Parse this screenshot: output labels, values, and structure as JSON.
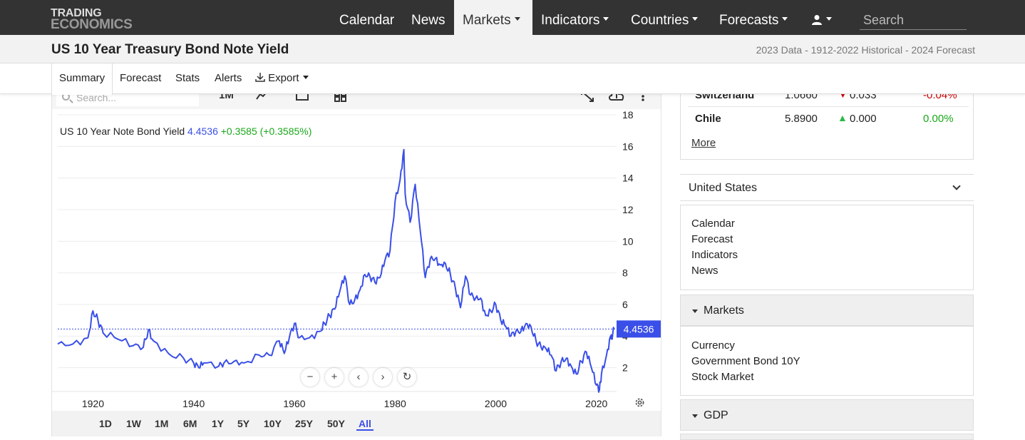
{
  "brand": {
    "line1": "TRADING",
    "line2": "ECONOMICS"
  },
  "nav": {
    "items": [
      {
        "label": "Calendar",
        "dropdown": false
      },
      {
        "label": "News",
        "dropdown": false
      },
      {
        "label": "Markets",
        "dropdown": true,
        "active": true
      },
      {
        "label": "Indicators",
        "dropdown": true
      },
      {
        "label": "Countries",
        "dropdown": true
      },
      {
        "label": "Forecasts",
        "dropdown": true
      }
    ],
    "search_placeholder": "Search"
  },
  "header": {
    "title": "US 10 Year Treasury Bond Note Yield",
    "meta": "2023 Data - 1912-2022 Historical - 2024 Forecast"
  },
  "tabs": [
    "Summary",
    "Forecast",
    "Stats",
    "Alerts",
    "Export"
  ],
  "chart_toolbar": {
    "search_placeholder": "Search...",
    "interval": "1M"
  },
  "chart_legend": {
    "name": "US 10 Year Note Bond Yield",
    "value": "4.4536",
    "change": "+0.3585 (+0.3585%)"
  },
  "chart_controls": [
    "−",
    "+",
    "‹",
    "›",
    "↻"
  ],
  "range_buttons": [
    "1D",
    "1W",
    "1M",
    "6M",
    "1Y",
    "5Y",
    "10Y",
    "25Y",
    "50Y",
    "All"
  ],
  "range_active": "All",
  "markets_table": {
    "rows": [
      {
        "name": "Switzerland",
        "price": "1.0660",
        "change": "0.033",
        "pct": "-0.04%",
        "direction": "down"
      },
      {
        "name": "Chile",
        "price": "5.8900",
        "change": "0.000",
        "pct": "0.00%",
        "direction": "up"
      }
    ],
    "more_label": "More"
  },
  "country_select": "United States",
  "country_links": [
    "Calendar",
    "Forecast",
    "Indicators",
    "News"
  ],
  "markets_section": {
    "title": "Markets",
    "links": [
      "Currency",
      "Government Bond 10Y",
      "Stock Market"
    ]
  },
  "gdp_section": {
    "title": "GDP"
  },
  "colors": {
    "series": "#3a4fe8",
    "up": "#1aa81a",
    "down": "#cc0000",
    "nav_bg": "#333333"
  },
  "chart_data": {
    "type": "line",
    "series": [
      {
        "name": "US 10 Year Note Bond Yield",
        "x": [
          1913,
          1916,
          1919,
          1920,
          1921,
          1922,
          1925,
          1928,
          1930,
          1931,
          1932,
          1935,
          1938,
          1940,
          1941,
          1942,
          1945,
          1946,
          1948,
          1950,
          1953,
          1955,
          1957,
          1958,
          1959,
          1960,
          1961,
          1963,
          1965,
          1966,
          1967,
          1968,
          1969,
          1970,
          1971,
          1972,
          1973,
          1974,
          1975,
          1976,
          1977,
          1978,
          1979,
          1980,
          1981,
          1981.75,
          1982,
          1983,
          1984,
          1985,
          1986,
          1987,
          1988,
          1989,
          1990,
          1991,
          1992,
          1993,
          1994,
          1995,
          1996,
          1997,
          1998,
          1999,
          2000,
          2001,
          2002,
          2003,
          2004,
          2005,
          2006,
          2007,
          2008,
          2009,
          2010,
          2011,
          2012,
          2013,
          2014,
          2015,
          2016,
          2017,
          2018,
          2019,
          2020,
          2020.6,
          2021,
          2022,
          2022.8,
          2023,
          2023.5
        ],
        "y": [
          3.5,
          3.5,
          3.9,
          5.6,
          5.0,
          4.2,
          3.8,
          3.4,
          3.3,
          4.4,
          3.7,
          2.9,
          2.6,
          2.3,
          2.0,
          2.3,
          2.1,
          2.3,
          2.4,
          2.3,
          2.8,
          2.8,
          3.7,
          2.9,
          3.9,
          4.8,
          3.9,
          3.9,
          4.3,
          4.8,
          5.3,
          5.7,
          6.8,
          7.8,
          6.0,
          6.3,
          6.9,
          7.9,
          7.8,
          7.4,
          7.7,
          8.8,
          9.4,
          12.5,
          13.9,
          15.8,
          13.0,
          11.2,
          13.6,
          10.7,
          7.7,
          8.9,
          8.9,
          8.5,
          8.6,
          7.9,
          7.0,
          5.8,
          7.8,
          6.6,
          6.4,
          6.4,
          5.3,
          5.6,
          6.0,
          5.0,
          4.6,
          4.0,
          4.3,
          4.3,
          4.8,
          4.6,
          3.7,
          3.3,
          3.2,
          2.8,
          1.8,
          2.4,
          2.6,
          2.1,
          1.6,
          2.4,
          3.0,
          2.0,
          0.9,
          0.6,
          1.6,
          2.8,
          4.0,
          3.9,
          4.45
        ]
      }
    ],
    "xlabel": "",
    "ylabel": "",
    "xlim": [
      1913,
      2024
    ],
    "ylim": [
      0,
      18
    ],
    "x_ticks": [
      "1920",
      "1940",
      "1960",
      "1980",
      "2000",
      "2020"
    ],
    "y_ticks": [
      "2",
      "4",
      "6",
      "8",
      "10",
      "12",
      "14",
      "16",
      "18"
    ],
    "last_value_label": "4.4536",
    "grid": true
  }
}
